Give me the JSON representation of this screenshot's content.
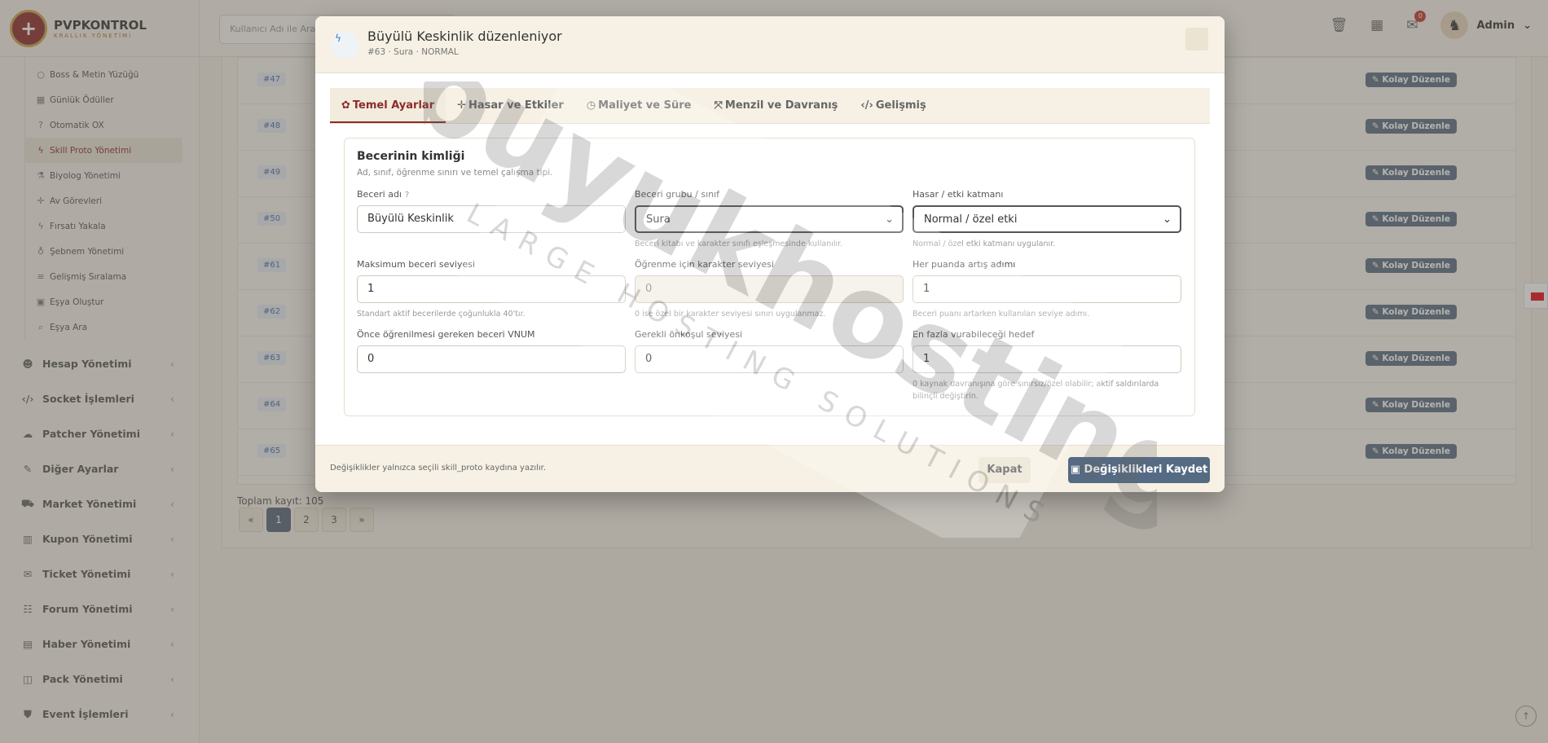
{
  "brand": {
    "name": "PVPKONTROL",
    "sub": "KRALLIK YÖNETİMİ"
  },
  "topbar": {
    "search_placeholder": "Kullanıcı Adı ile Ara",
    "notif_count": "0",
    "user": "Admin"
  },
  "sidebar": {
    "sub_items": [
      {
        "label": "Boss & Metin Yüzüğü",
        "icon": "ring-icon"
      },
      {
        "label": "Günlük Ödüller",
        "icon": "calendar-icon"
      },
      {
        "label": "Otomatik OX",
        "icon": "question-icon"
      },
      {
        "label": "Skill Proto Yönetimi",
        "icon": "bolt-icon",
        "active": true
      },
      {
        "label": "Biyolog Yönetimi",
        "icon": "flask-icon"
      },
      {
        "label": "Av Görevleri",
        "icon": "crosshair-icon"
      },
      {
        "label": "Fırsatı Yakala",
        "icon": "bolt-icon"
      },
      {
        "label": "Şebnem Yönetimi",
        "icon": "potion-icon"
      },
      {
        "label": "Gelişmiş Sıralama",
        "icon": "ranking-icon"
      },
      {
        "label": "Eşya Oluştur",
        "icon": "box-icon"
      },
      {
        "label": "Eşya Ara",
        "icon": "search-icon"
      }
    ],
    "nav_items": [
      {
        "label": "Hesap Yönetimi",
        "icon": "users-icon"
      },
      {
        "label": "Socket İşlemleri",
        "icon": "code-icon"
      },
      {
        "label": "Patcher Yönetimi",
        "icon": "cloud-icon"
      },
      {
        "label": "Diğer Ayarlar",
        "icon": "wrench-icon"
      },
      {
        "label": "Market Yönetimi",
        "icon": "cart-icon"
      },
      {
        "label": "Kupon Yönetimi",
        "icon": "barcode-icon"
      },
      {
        "label": "Ticket Yönetimi",
        "icon": "ticket-icon"
      },
      {
        "label": "Forum Yönetimi",
        "icon": "comments-icon"
      },
      {
        "label": "Haber Yönetimi",
        "icon": "newspaper-icon"
      },
      {
        "label": "Pack Yönetimi",
        "icon": "archive-icon"
      },
      {
        "label": "Event İşlemleri",
        "icon": "shield-icon"
      }
    ]
  },
  "table": {
    "rows": [
      "#47",
      "#48",
      "#49",
      "#50",
      "#61",
      "#62",
      "#63",
      "#64",
      "#65"
    ],
    "edit_label": "Kolay Düzenle",
    "total": "Toplam kayıt: 105",
    "pages": [
      "«",
      "1",
      "2",
      "3",
      "»"
    ]
  },
  "modal": {
    "title": "Büyülü Keskinlik düzenleniyor",
    "subtitle": "#63 · Sura · NORMAL",
    "tabs": [
      "Temel Ayarlar",
      "Hasar ve Etkiler",
      "Maliyet ve Süre",
      "Menzil ve Davranış",
      "Gelişmiş"
    ],
    "card_title": "Becerinin kimliği",
    "card_sub": "Ad, sınıf, öğrenme sınırı ve temel çalışma tipi.",
    "fields": [
      {
        "label": "Beceri adı",
        "value": "Büyülü Keskinlik",
        "help": ""
      },
      {
        "label": "Beceri grubu / sınıf",
        "value": "Sura",
        "help": "Beceri kitabı ve karakter sınıfı eşleşmesinde kullanılır."
      },
      {
        "label": "Hasar / etki katmanı",
        "value": "Normal / özel etki",
        "help": "Normal / özel etki katmanı uygulanır."
      },
      {
        "label": "Maksimum beceri seviyesi",
        "value": "1",
        "help": "Standart aktif becerilerde çoğunlukla 40'tır."
      },
      {
        "label": "Öğrenme için karakter seviyesi",
        "value": "0",
        "help": "0 ise özel bir karakter seviyesi sınırı uygulanmaz."
      },
      {
        "label": "Her puanda artış adımı",
        "value": "1",
        "help": "Beceri puanı artarken kullanılan seviye adımı."
      },
      {
        "label": "Önce öğrenilmesi gereken beceri VNUM",
        "value": "0",
        "help": ""
      },
      {
        "label": "Gerekli önkoşul seviyesi",
        "value": "0",
        "help": ""
      },
      {
        "label": "En fazla vurabileceği hedef",
        "value": "1",
        "help": "0 kaynak davranışına göre sınırsız/özel olabilir; aktif saldırılarda bilinçli değiştirin."
      }
    ],
    "footer_note": "Değişiklikler yalnızca seçili skill_proto kaydına yazılır.",
    "close_label": "Kapat",
    "save_label": "Değişiklikleri Kaydet"
  },
  "watermark": {
    "main": "buyukhosting",
    "sub": "LARGE HOSTING SOLUTIONS"
  }
}
